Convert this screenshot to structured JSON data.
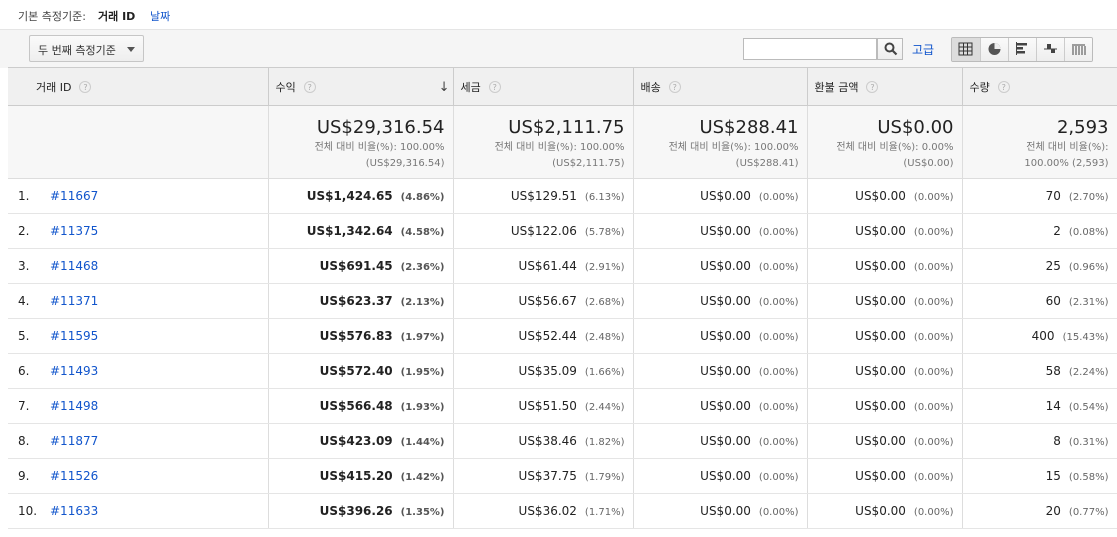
{
  "dimension_bar": {
    "label": "기본 측정기준:",
    "current": "거래 ID",
    "alternate": "날짜"
  },
  "toolbar": {
    "secondary_dimension": "두 번째 측정기준",
    "search_placeholder": "",
    "advanced": "고급",
    "views": [
      "table-view-icon",
      "pie-view-icon",
      "performance-view-icon",
      "comparison-view-icon",
      "pivot-view-icon"
    ]
  },
  "columns": [
    {
      "label": "거래 ID"
    },
    {
      "label": "수익",
      "sorted": "desc"
    },
    {
      "label": "세금"
    },
    {
      "label": "배송"
    },
    {
      "label": "환불 금액"
    },
    {
      "label": "수량"
    }
  ],
  "help_glyph": "?",
  "sort_glyph": "↓",
  "totals": [
    {
      "value": "US$29,316.54",
      "sub1": "전체 대비 비율(%): 100.00%",
      "sub2": "(US$29,316.54)"
    },
    {
      "value": "US$2,111.75",
      "sub1": "전체 대비 비율(%): 100.00%",
      "sub2": "(US$2,111.75)"
    },
    {
      "value": "US$288.41",
      "sub1": "전체 대비 비율(%): 100.00%",
      "sub2": "(US$288.41)"
    },
    {
      "value": "US$0.00",
      "sub1": "전체 대비 비율(%): 0.00%",
      "sub2": "(US$0.00)"
    },
    {
      "value": "2,593",
      "sub1": "전체 대비 비율(%):",
      "sub2": "100.00% (2,593)"
    }
  ],
  "rows": [
    {
      "rank": "1.",
      "id": "#11667",
      "cells": [
        [
          "US$1,424.65",
          "(4.86%)"
        ],
        [
          "US$129.51",
          "(6.13%)"
        ],
        [
          "US$0.00",
          "(0.00%)"
        ],
        [
          "US$0.00",
          "(0.00%)"
        ],
        [
          "70",
          "(2.70%)"
        ]
      ]
    },
    {
      "rank": "2.",
      "id": "#11375",
      "cells": [
        [
          "US$1,342.64",
          "(4.58%)"
        ],
        [
          "US$122.06",
          "(5.78%)"
        ],
        [
          "US$0.00",
          "(0.00%)"
        ],
        [
          "US$0.00",
          "(0.00%)"
        ],
        [
          "2",
          "(0.08%)"
        ]
      ]
    },
    {
      "rank": "3.",
      "id": "#11468",
      "cells": [
        [
          "US$691.45",
          "(2.36%)"
        ],
        [
          "US$61.44",
          "(2.91%)"
        ],
        [
          "US$0.00",
          "(0.00%)"
        ],
        [
          "US$0.00",
          "(0.00%)"
        ],
        [
          "25",
          "(0.96%)"
        ]
      ]
    },
    {
      "rank": "4.",
      "id": "#11371",
      "cells": [
        [
          "US$623.37",
          "(2.13%)"
        ],
        [
          "US$56.67",
          "(2.68%)"
        ],
        [
          "US$0.00",
          "(0.00%)"
        ],
        [
          "US$0.00",
          "(0.00%)"
        ],
        [
          "60",
          "(2.31%)"
        ]
      ]
    },
    {
      "rank": "5.",
      "id": "#11595",
      "cells": [
        [
          "US$576.83",
          "(1.97%)"
        ],
        [
          "US$52.44",
          "(2.48%)"
        ],
        [
          "US$0.00",
          "(0.00%)"
        ],
        [
          "US$0.00",
          "(0.00%)"
        ],
        [
          "400",
          "(15.43%)"
        ]
      ]
    },
    {
      "rank": "6.",
      "id": "#11493",
      "cells": [
        [
          "US$572.40",
          "(1.95%)"
        ],
        [
          "US$35.09",
          "(1.66%)"
        ],
        [
          "US$0.00",
          "(0.00%)"
        ],
        [
          "US$0.00",
          "(0.00%)"
        ],
        [
          "58",
          "(2.24%)"
        ]
      ]
    },
    {
      "rank": "7.",
      "id": "#11498",
      "cells": [
        [
          "US$566.48",
          "(1.93%)"
        ],
        [
          "US$51.50",
          "(2.44%)"
        ],
        [
          "US$0.00",
          "(0.00%)"
        ],
        [
          "US$0.00",
          "(0.00%)"
        ],
        [
          "14",
          "(0.54%)"
        ]
      ]
    },
    {
      "rank": "8.",
      "id": "#11877",
      "cells": [
        [
          "US$423.09",
          "(1.44%)"
        ],
        [
          "US$38.46",
          "(1.82%)"
        ],
        [
          "US$0.00",
          "(0.00%)"
        ],
        [
          "US$0.00",
          "(0.00%)"
        ],
        [
          "8",
          "(0.31%)"
        ]
      ]
    },
    {
      "rank": "9.",
      "id": "#11526",
      "cells": [
        [
          "US$415.20",
          "(1.42%)"
        ],
        [
          "US$37.75",
          "(1.79%)"
        ],
        [
          "US$0.00",
          "(0.00%)"
        ],
        [
          "US$0.00",
          "(0.00%)"
        ],
        [
          "15",
          "(0.58%)"
        ]
      ]
    },
    {
      "rank": "10.",
      "id": "#11633",
      "cells": [
        [
          "US$396.26",
          "(1.35%)"
        ],
        [
          "US$36.02",
          "(1.71%)"
        ],
        [
          "US$0.00",
          "(0.00%)"
        ],
        [
          "US$0.00",
          "(0.00%)"
        ],
        [
          "20",
          "(0.77%)"
        ]
      ]
    }
  ]
}
